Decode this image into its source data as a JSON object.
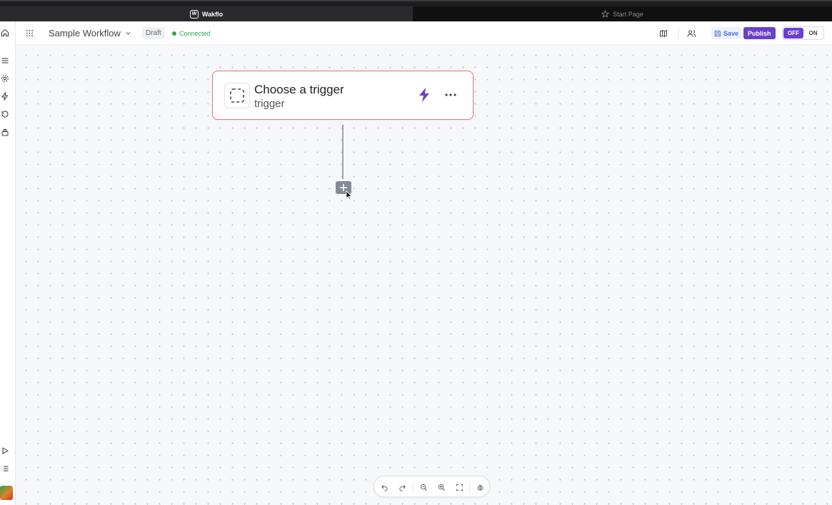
{
  "browser": {
    "tabs": [
      {
        "label": "Wakflo",
        "icon": "wakflo-logo-icon",
        "active": true
      },
      {
        "label": "Start Page",
        "icon": "star-icon",
        "active": false
      }
    ]
  },
  "sidebar": {
    "items": [
      {
        "name": "home",
        "icon": "home-icon"
      },
      {
        "name": "menu",
        "icon": "menu-icon"
      },
      {
        "name": "settings",
        "icon": "gear-icon"
      },
      {
        "name": "triggers",
        "icon": "bolt-icon"
      },
      {
        "name": "history",
        "icon": "history-icon"
      },
      {
        "name": "layers",
        "icon": "layers-icon"
      },
      {
        "name": "run",
        "icon": "play-icon"
      },
      {
        "name": "logs",
        "icon": "list-icon"
      }
    ]
  },
  "toolbar": {
    "title": "Sample Workflow",
    "status_badge": "Draft",
    "connection_status": "Connected",
    "save_label": "Save",
    "publish_label": "Publish",
    "toggle_off_label": "OFF",
    "toggle_on_label": "ON",
    "toggle_state": "OFF"
  },
  "canvas": {
    "trigger_card": {
      "title": "Choose a trigger",
      "subtitle": "trigger"
    }
  },
  "colors": {
    "accent": "#6b3fd0",
    "connected": "#2ba84a",
    "card_border": "#e07a7a",
    "save": "#4b6cd8"
  }
}
